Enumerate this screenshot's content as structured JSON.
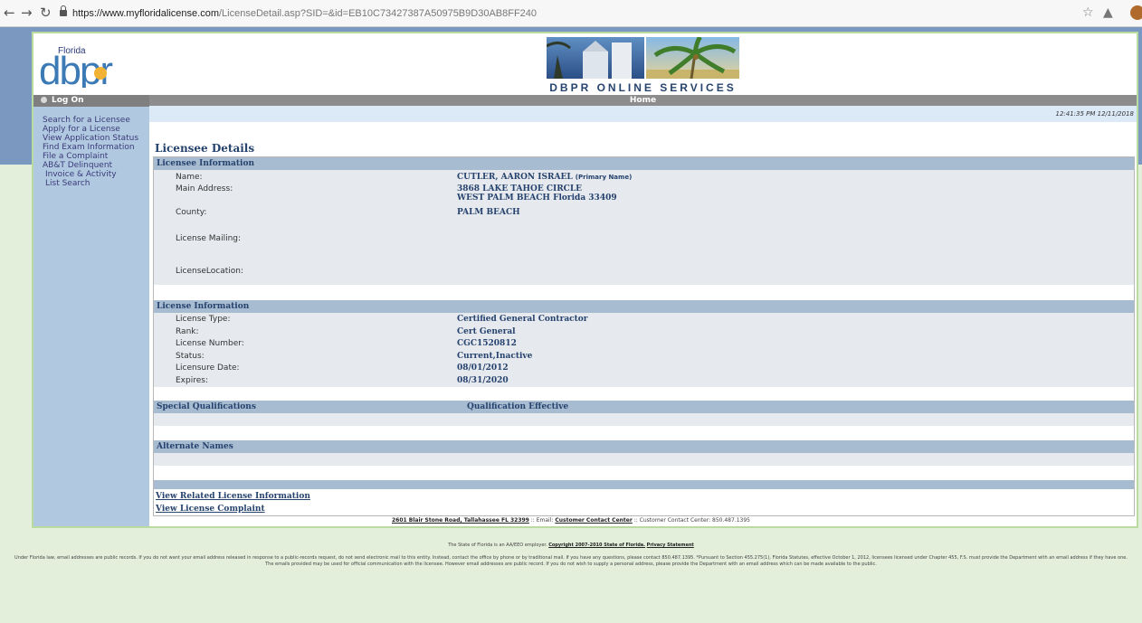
{
  "browser": {
    "url_host": "https://www.myfloridalicense.com",
    "url_path": "/LicenseDetail.asp?SID=&id=EB10C73427387A50975B9D30AB8FF240"
  },
  "header": {
    "logo_small": "Florida",
    "logo_big": "dbpr",
    "banner_caption": "DBPR ONLINE SERVICES",
    "home_label": "Home",
    "timestamp": "12:41:35 PM 12/11/2018"
  },
  "sidebar": {
    "logon_label": "Log On",
    "items": [
      {
        "label": "Search for a Licensee"
      },
      {
        "label": "Apply for a License"
      },
      {
        "label": "View Application Status"
      },
      {
        "label": "Find Exam Information"
      },
      {
        "label": "File a Complaint"
      },
      {
        "label": "AB&T Delinquent"
      },
      {
        "label": "Invoice & Activity"
      },
      {
        "label": "List Search"
      }
    ]
  },
  "page_title": "Licensee Details",
  "licensee": {
    "heading": "Licensee Information",
    "name_label": "Name:",
    "name_value": "CUTLER, AARON ISRAEL",
    "name_note": "(Primary Name)",
    "address_label": "Main Address:",
    "address_line1": "3868 LAKE TAHOE CIRCLE",
    "address_line2": "WEST PALM BEACH  Florida  33409",
    "county_label": "County:",
    "county_value": "PALM BEACH",
    "mailing_label": "License Mailing:",
    "location_label": "LicenseLocation:"
  },
  "license": {
    "heading": "License Information",
    "rows": [
      {
        "label": "License Type:",
        "value": "Certified General Contractor"
      },
      {
        "label": "Rank:",
        "value": "Cert General"
      },
      {
        "label": "License Number:",
        "value": "CGC1520812"
      },
      {
        "label": "Status:",
        "value": "Current,Inactive"
      },
      {
        "label": "Licensure Date:",
        "value": "08/01/2012"
      },
      {
        "label": "Expires:",
        "value": "08/31/2020"
      }
    ]
  },
  "special": {
    "heading": "Special Qualifications",
    "heading2": "Qualification Effective"
  },
  "alternate": {
    "heading": "Alternate Names"
  },
  "links": {
    "related": "View Related License Information",
    "complaint": "View License Complaint"
  },
  "footer": {
    "address_link": "2601 Blair Stone Road, Tallahassee FL 32399",
    "email_prefix": ":: Email:",
    "contact_link": "Customer Contact Center",
    "contact_suffix": ":: Customer Contact Center: 850.487.1395",
    "employer_text": "The State of Florida is an AA/EEO employer.",
    "copyright_link": "Copyright 2007-2010 State of Florida.",
    "privacy_link": "Privacy Statement",
    "disclaimer": "Under Florida law, email addresses are public records. If you do not want your email address released in response to a public-records request, do not send electronic mail to this entity. Instead, contact the office by phone or by traditional mail. If you have any questions, please contact 850.487.1395. *Pursuant to Section 455.275(1), Florida Statutes, effective October 1, 2012, licensees licensed under Chapter 455, F.S. must provide the Department with an email address if they have one. The emails provided may be used for official communication with the licensee. However email addresses are public record. If you do not wish to supply a personal address, please provide the Department with an email address which can be made available to the public."
  },
  "colors": {
    "navy": "#26436e",
    "sidebar": "#b1c9e0",
    "section_header": "#a7bbd1",
    "page_bg": "#e3eedb"
  }
}
